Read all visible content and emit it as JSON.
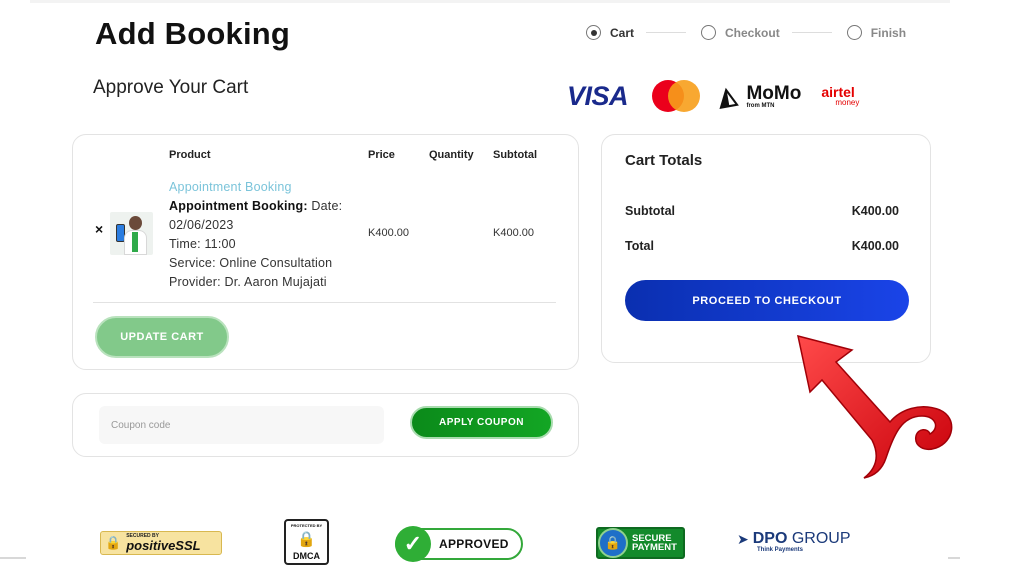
{
  "page": {
    "title": "Add Booking",
    "subtitle": "Approve Your Cart"
  },
  "steps": [
    "Cart",
    "Checkout",
    "Finish"
  ],
  "active_step": "Cart",
  "payment_logos": {
    "visa": "VISA",
    "mastercard_icon": "mastercard-icon",
    "momo": "MoMo",
    "momo_sub": "from MTN",
    "airtel": "airtel",
    "airtel_sub": "money"
  },
  "cart": {
    "columns": {
      "product": "Product",
      "price": "Price",
      "quantity": "Quantity",
      "subtotal": "Subtotal"
    },
    "items": [
      {
        "remove": "×",
        "link": "Appointment Booking",
        "booking_label": "Appointment Booking:",
        "date_label": "Date:",
        "date": "02/06/2023",
        "time": "Time: 11:00",
        "service": "Service: Online Consultation",
        "provider": "Provider: Dr. Aaron Mujajati",
        "price": "K400.00",
        "quantity": "",
        "subtotal": "K400.00"
      }
    ],
    "update_button": "UPDATE CART"
  },
  "coupon": {
    "placeholder": "Coupon code",
    "value": "",
    "apply_button": "APPLY COUPON"
  },
  "totals": {
    "title": "Cart Totals",
    "subtotal_label": "Subtotal",
    "subtotal_value": "K400.00",
    "total_label": "Total",
    "total_value": "K400.00",
    "checkout_button": "PROCEED TO CHECKOUT"
  },
  "trust_badges": {
    "ssl_small": "SECURED BY",
    "ssl_large": "positiveSSL",
    "dmca_small": "PROTECTED BY",
    "dmca_large": "DMCA",
    "approved": "APPROVED",
    "secure_line1": "SECURE",
    "secure_line2": "PAYMENT",
    "dpo_large": "DPO",
    "dpo_large2": "GROUP",
    "dpo_small": "Think Payments"
  },
  "colors": {
    "checkout_blue": "#1a44e8",
    "apply_green": "#0b8a1a",
    "update_green": "#82c98a",
    "link_blue": "#7bc4da",
    "arrow_red": "#e8101a"
  }
}
